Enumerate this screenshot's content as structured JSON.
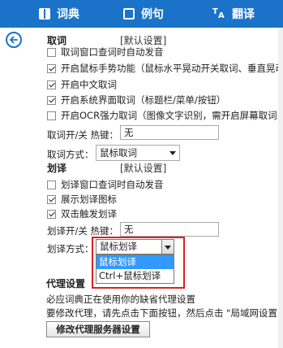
{
  "nav": {
    "dict_label": "词典",
    "sentence_label": "例句",
    "translate_label": "翻译",
    "translate_icon_top": "T",
    "translate_icon_bottom": "A"
  },
  "quci": {
    "header": "取词",
    "tag": "[默认设置]",
    "options": [
      {
        "label": "取词窗口查词时自动发音",
        "checked": false
      },
      {
        "label": "开启鼠标手势功能（鼠标水平晃动开关取词、垂直晃动",
        "checked": true
      },
      {
        "label": "开启中文取词",
        "checked": true
      },
      {
        "label": "开启系统界面取词（标题栏/菜单/按钮）",
        "checked": true
      },
      {
        "label": "开启OCR强力取词（图像文字识别，需开启屏幕取词",
        "checked": false
      }
    ],
    "hotkey_label": "取词开/关 热键：",
    "hotkey_value": "无",
    "mode_label": "取词方式：",
    "mode_value": "鼠标取词"
  },
  "huayi": {
    "header": "划译",
    "tag": "[默认设置]",
    "options": [
      {
        "label": "划译窗口查词时自动发音",
        "checked": false
      },
      {
        "label": "展示划译图标",
        "checked": true
      },
      {
        "label": "双击触发划译",
        "checked": true
      }
    ],
    "hotkey_label": "划译开/关 热键：",
    "hotkey_value": "无",
    "mode_label": "划译方式：",
    "mode_value": "鼠标划译",
    "mode_options": [
      "鼠标划译",
      "Ctrl+鼠标划译"
    ]
  },
  "proxy": {
    "header": "代理设置",
    "line1": "必应词典正在使用你的缺省代理设置",
    "line2": "要修改代理，请先点击下面按钮，然后点击 \"局域网设置\"",
    "button_label": "修改代理服务器设置"
  },
  "colors": {
    "nav_bg": "#1a73c8",
    "highlight": "#e02020",
    "selection": "#3399ff"
  }
}
